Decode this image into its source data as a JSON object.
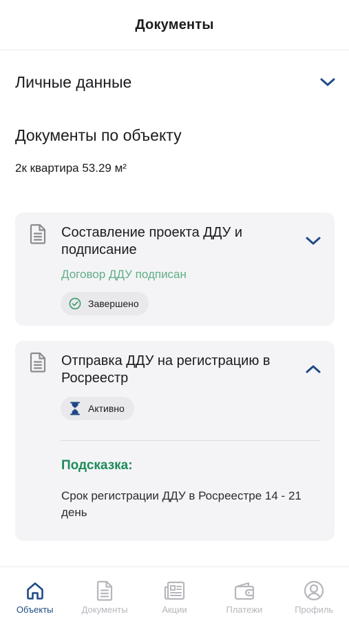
{
  "header": {
    "title": "Документы"
  },
  "personal": {
    "label": "Личные данные",
    "chevron_icon": "chevron-down-icon"
  },
  "section": {
    "title": "Документы по объекту",
    "object_name": "2к квартира 53.29 м²"
  },
  "cards": [
    {
      "title": "Составление проекта ДДУ и подписание",
      "status_text": "Договор ДДУ подписан",
      "badge": "Завершено",
      "badge_icon": "check-circle-icon",
      "expanded": false
    },
    {
      "title": "Отправка ДДУ на регистрацию в Росреестр",
      "badge": "Активно",
      "badge_icon": "hourglass-icon",
      "expanded": true,
      "hint_title": "Подсказка:",
      "hint_text": "Срок регистрации ДДУ в Росреестре 14 - 21 день"
    }
  ],
  "tabbar": {
    "items": [
      {
        "label": "Объекты",
        "icon": "home-icon",
        "active": true
      },
      {
        "label": "Документы",
        "icon": "document-icon",
        "active": false
      },
      {
        "label": "Акции",
        "icon": "news-icon",
        "active": false
      },
      {
        "label": "Платежи",
        "icon": "wallet-icon",
        "active": false
      },
      {
        "label": "Профиль",
        "icon": "profile-icon",
        "active": false
      }
    ]
  },
  "colors": {
    "accent": "#1f4a87",
    "success_text": "#5fae86",
    "hint_title": "#1e8a5a",
    "card_bg": "#f4f4f6",
    "inactive": "#b6b6bc"
  }
}
